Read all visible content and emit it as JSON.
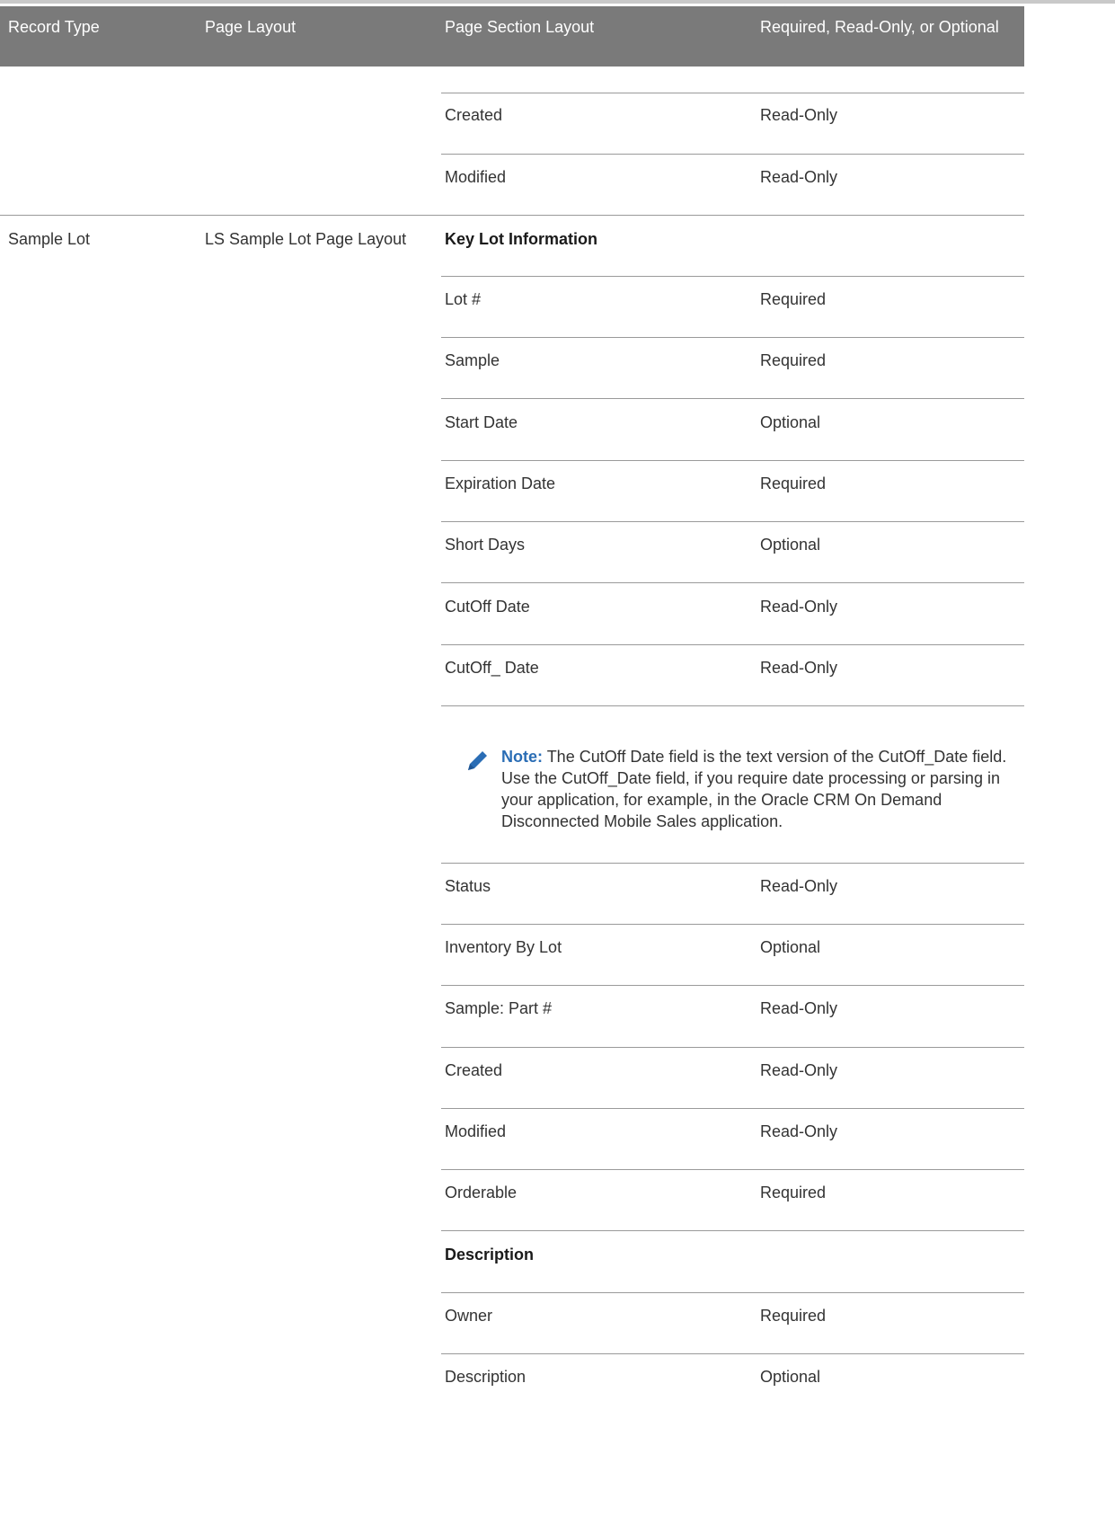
{
  "table": {
    "headers": [
      "Record Type",
      "Page Layout",
      "Page Section Layout",
      "Required, Read-Only, or Optional"
    ],
    "continued_rows": [
      {
        "field": "Created",
        "status": "Read-Only"
      },
      {
        "field": "Modified",
        "status": "Read-Only"
      }
    ],
    "sample_lot": {
      "record_type": "Sample Lot",
      "page_layout": "LS Sample Lot Page Layout",
      "section_key_lot": "Key Lot Information",
      "rows_before_note": [
        {
          "field": "Lot #",
          "status": "Required"
        },
        {
          "field": "Sample",
          "status": "Required"
        },
        {
          "field": "Start Date",
          "status": "Optional"
        },
        {
          "field": "Expiration Date",
          "status": "Required"
        },
        {
          "field": "Short Days",
          "status": "Optional"
        },
        {
          "field": "CutOff Date",
          "status": "Read-Only"
        },
        {
          "field": "CutOff_ Date",
          "status": "Read-Only"
        }
      ],
      "note": {
        "label": "Note:",
        "text": "The CutOff Date field is the text version of the CutOff_Date field. Use the CutOff_Date field, if you require date processing or parsing in your application, for example, in the Oracle CRM On Demand Disconnected Mobile Sales application."
      },
      "rows_after_note": [
        {
          "field": "Status",
          "status": "Read-Only"
        },
        {
          "field": "Inventory By Lot",
          "status": "Optional"
        },
        {
          "field": "Sample: Part #",
          "status": "Read-Only"
        },
        {
          "field": "Created",
          "status": "Read-Only"
        },
        {
          "field": "Modified",
          "status": "Read-Only"
        },
        {
          "field": "Orderable",
          "status": "Required"
        }
      ],
      "section_description": "Description",
      "rows_description": [
        {
          "field": "Owner",
          "status": "Required"
        },
        {
          "field": "Description",
          "status": "Optional"
        }
      ]
    }
  },
  "colors": {
    "header_bg": "#7a7a7a",
    "note_accent": "#2a6db5",
    "rule": "#9a9a9a"
  },
  "icons": {
    "note": "pencil-icon"
  }
}
